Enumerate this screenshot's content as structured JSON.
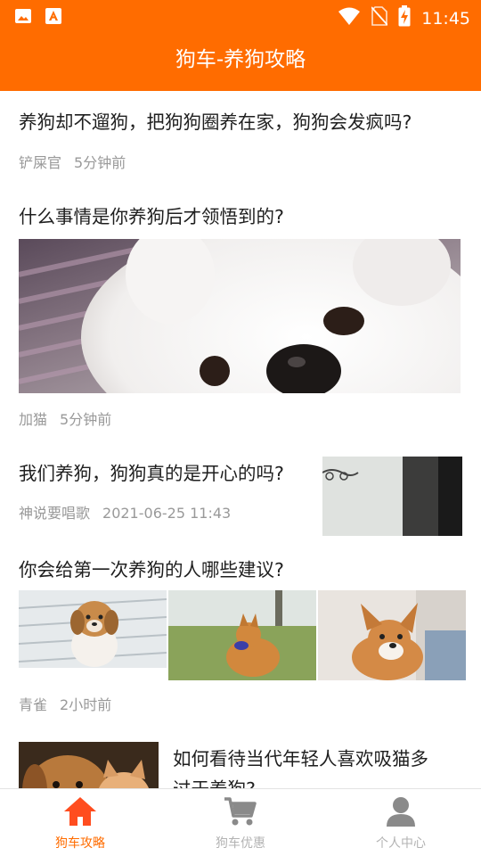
{
  "status_bar": {
    "time": "11:45",
    "icons": [
      "image-icon",
      "app-store-icon",
      "wifi-icon",
      "no-sim-icon",
      "battery-charging-icon"
    ]
  },
  "app_bar": {
    "title": "狗车-养狗攻略"
  },
  "articles": [
    {
      "title": "养狗却不遛狗，把狗狗圈养在家，狗狗会发疯吗?",
      "author": "铲屎官",
      "time": "5分钟前",
      "layout": "text-only"
    },
    {
      "title": "什么事情是你养狗后才领悟到的?",
      "author": "加猫",
      "time": "5分钟前",
      "layout": "large-image",
      "image": "white-dog-closeup"
    },
    {
      "title": "我们养狗，狗狗真的是开心的吗?",
      "author": "神说要唱歌",
      "time": "2021-06-25 11:43",
      "layout": "right-thumbnail",
      "image": "room-doorway"
    },
    {
      "title": "你会给第一次养狗的人哪些建议?",
      "author": "青雀",
      "time": "2小时前",
      "layout": "three-images",
      "images": [
        "puppy-on-deck",
        "corgi-on-grass",
        "corgi-with-person"
      ]
    },
    {
      "title_line1": "如何看待当代年轻人喜欢吸猫多",
      "title_line2": "过于养狗?",
      "layout": "left-thumbnail",
      "image": "dog-and-kitten"
    }
  ],
  "bottom_nav": {
    "items": [
      {
        "label": "狗车攻略",
        "icon": "home-icon",
        "active": true
      },
      {
        "label": "狗车优惠",
        "icon": "cart-icon",
        "active": false
      },
      {
        "label": "个人中心",
        "icon": "user-icon",
        "active": false
      }
    ]
  },
  "colors": {
    "accent": "#ff6c00",
    "meta_text": "#999999",
    "inactive_nav": "#b3b3b3"
  }
}
